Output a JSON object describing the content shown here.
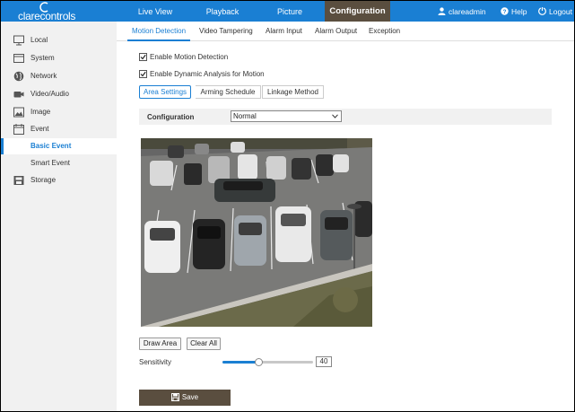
{
  "brand": {
    "name": "clarecontrols"
  },
  "nav": {
    "items": [
      {
        "label": "Live View"
      },
      {
        "label": "Playback"
      },
      {
        "label": "Picture"
      },
      {
        "label": "Configuration"
      }
    ],
    "active": "Configuration"
  },
  "user": {
    "name": "clareadmin",
    "help": "Help",
    "logout": "Logout"
  },
  "sidebar": {
    "items": [
      {
        "label": "Local",
        "icon": "monitor-icon"
      },
      {
        "label": "System",
        "icon": "system-icon"
      },
      {
        "label": "Network",
        "icon": "globe-icon"
      },
      {
        "label": "Video/Audio",
        "icon": "video-audio-icon"
      },
      {
        "label": "Image",
        "icon": "image-icon"
      },
      {
        "label": "Event",
        "icon": "calendar-icon"
      },
      {
        "label": "Basic Event"
      },
      {
        "label": "Smart Event"
      },
      {
        "label": "Storage",
        "icon": "storage-icon"
      }
    ],
    "active": "Basic Event"
  },
  "tabs": {
    "items": [
      "Motion Detection",
      "Video Tampering",
      "Alarm Input",
      "Alarm Output",
      "Exception"
    ],
    "active": "Motion Detection"
  },
  "options": {
    "enable_motion": {
      "label": "Enable Motion Detection",
      "checked": true
    },
    "enable_dynamic": {
      "label": "Enable Dynamic Analysis for Motion",
      "checked": true
    }
  },
  "subtabs": {
    "items": [
      "Area Settings",
      "Arming Schedule",
      "Linkage Method"
    ],
    "active": "Area Settings"
  },
  "configuration": {
    "label": "Configuration",
    "value": "Normal"
  },
  "buttons": {
    "draw_area": "Draw Area",
    "clear_all": "Clear All",
    "save": "Save"
  },
  "sensitivity": {
    "label": "Sensitivity",
    "value": "40",
    "level": 0.4
  },
  "colors": {
    "accent": "#1a7fd3",
    "header_active": "#5a4e3f",
    "sidebar_bg": "#f1f1f1"
  }
}
